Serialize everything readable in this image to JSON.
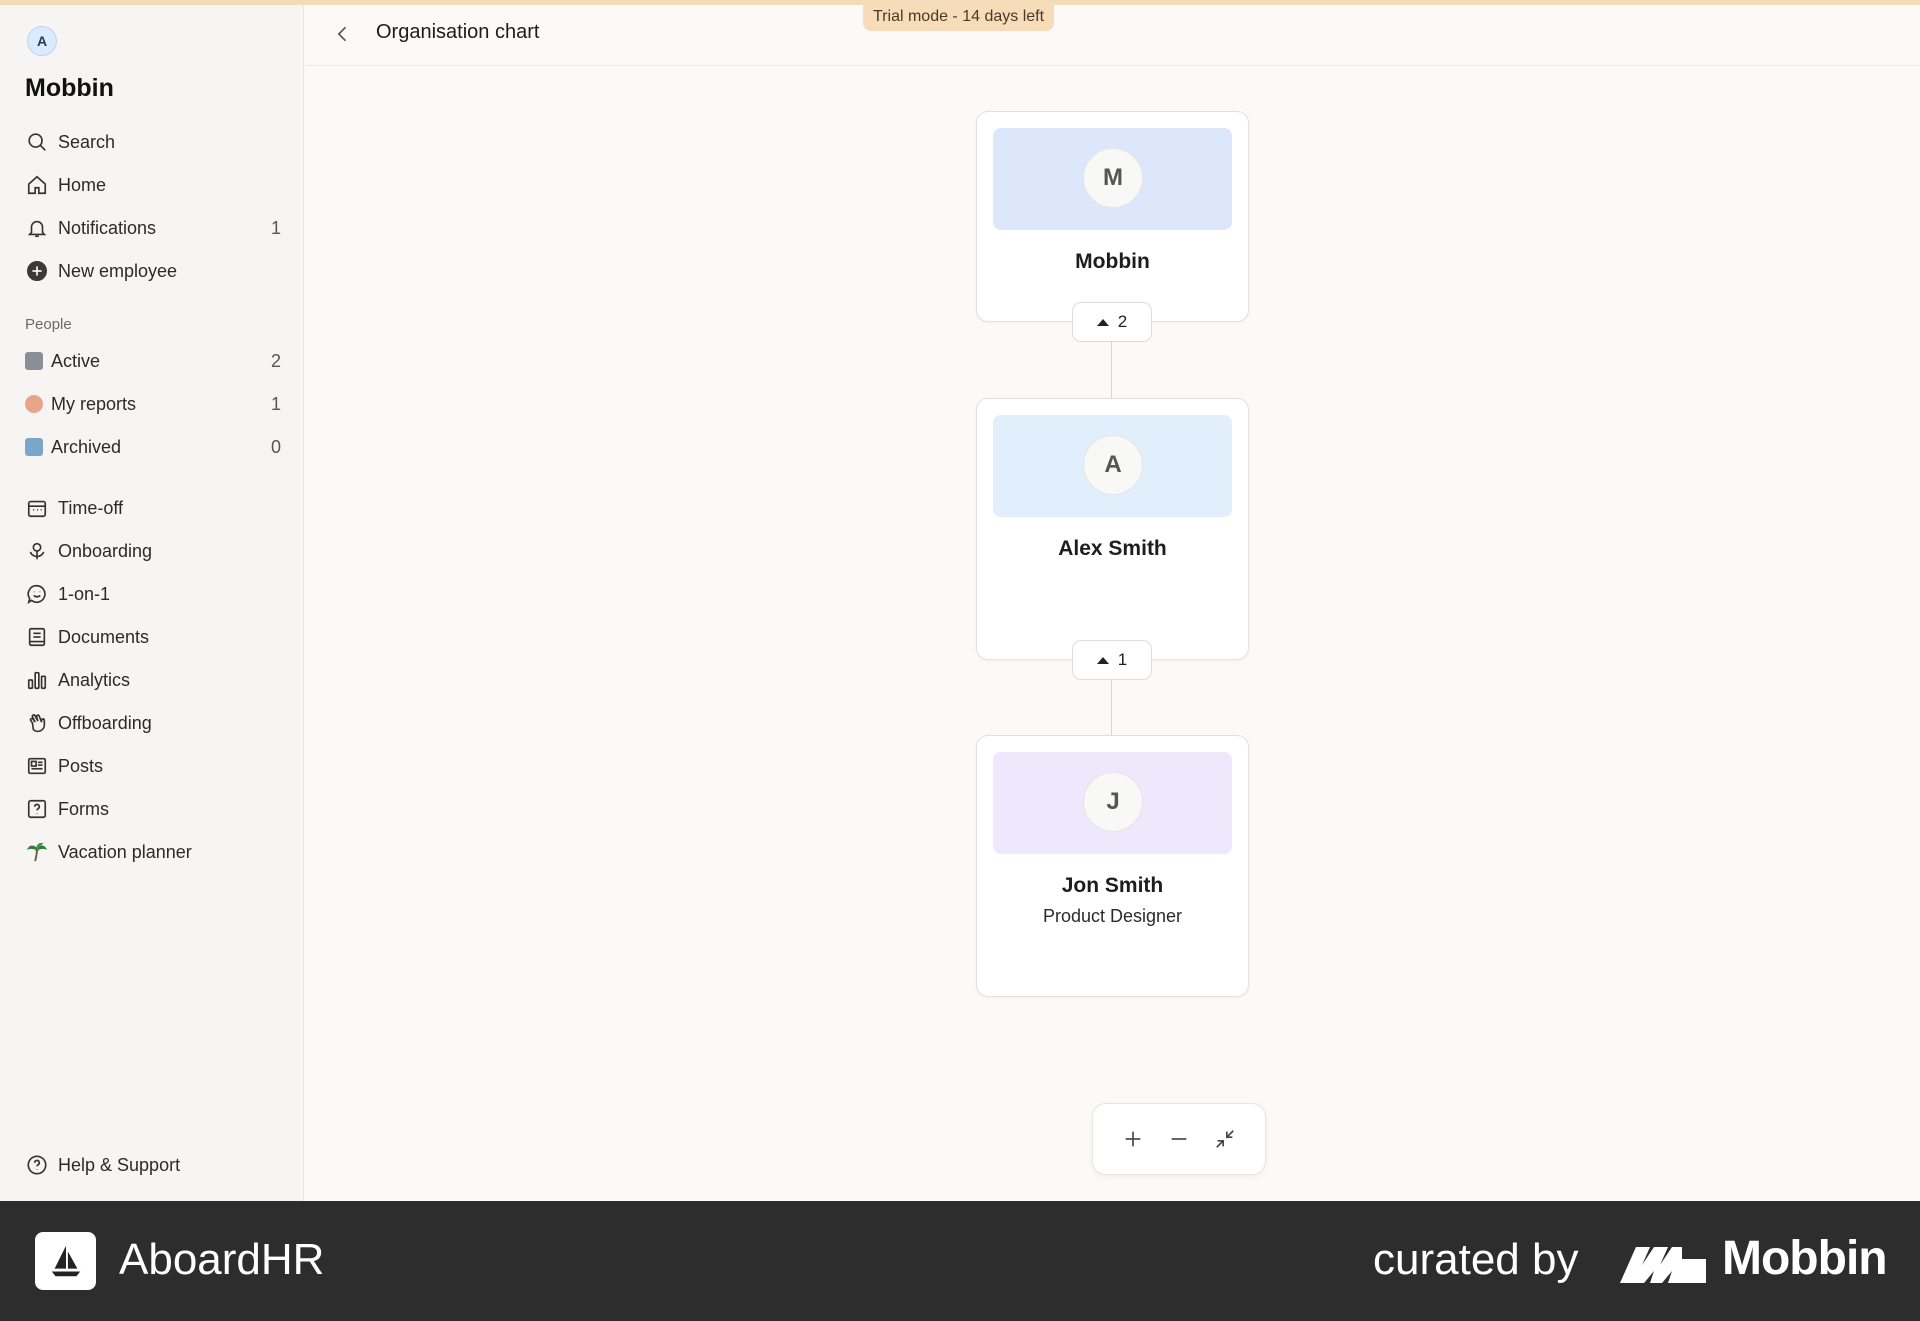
{
  "trial_banner": "Trial mode - 14 days left",
  "workspace": {
    "avatar_letter": "A",
    "name": "Mobbin"
  },
  "sidebar": {
    "top_items": [
      {
        "label": "Search",
        "icon": "search-icon"
      },
      {
        "label": "Home",
        "icon": "home-icon"
      },
      {
        "label": "Notifications",
        "icon": "bell-icon",
        "count": "1"
      },
      {
        "label": "New employee",
        "icon": "plus-circle-icon"
      }
    ],
    "people_label": "People",
    "people_items": [
      {
        "label": "Active",
        "icon": "building-emoji-icon",
        "count": "2"
      },
      {
        "label": "My reports",
        "icon": "bear-emoji-icon",
        "count": "1"
      },
      {
        "label": "Archived",
        "icon": "box-emoji-icon",
        "count": "0"
      }
    ],
    "tool_items": [
      {
        "label": "Time-off",
        "icon": "calendar-icon"
      },
      {
        "label": "Onboarding",
        "icon": "flower-icon"
      },
      {
        "label": "1-on-1",
        "icon": "smiley-chat-icon"
      },
      {
        "label": "Documents",
        "icon": "document-icon"
      },
      {
        "label": "Analytics",
        "icon": "bar-chart-icon"
      },
      {
        "label": "Offboarding",
        "icon": "waving-hand-icon"
      },
      {
        "label": "Posts",
        "icon": "newspaper-icon"
      },
      {
        "label": "Forms",
        "icon": "question-form-icon"
      },
      {
        "label": "Vacation planner",
        "icon": "palm-tree-icon"
      }
    ],
    "help_label": "Help & Support"
  },
  "header": {
    "title": "Organisation chart"
  },
  "org_chart": {
    "nodes": [
      {
        "initial": "M",
        "name": "Mobbin",
        "role": "",
        "banner_color": "#dde7fb",
        "children_count": "2"
      },
      {
        "initial": "A",
        "name": "Alex Smith",
        "role": "",
        "banner_color": "#e1eefb",
        "children_count": "1"
      },
      {
        "initial": "J",
        "name": "Jon Smith",
        "role": "Product Designer",
        "banner_color": "#efe7fb"
      }
    ]
  },
  "zoom_controls": [
    "zoom-in-icon",
    "zoom-out-icon",
    "fit-view-icon"
  ],
  "footer": {
    "app_name": "AboardHR",
    "curated_by": "curated by",
    "brand": "Mobbin"
  }
}
